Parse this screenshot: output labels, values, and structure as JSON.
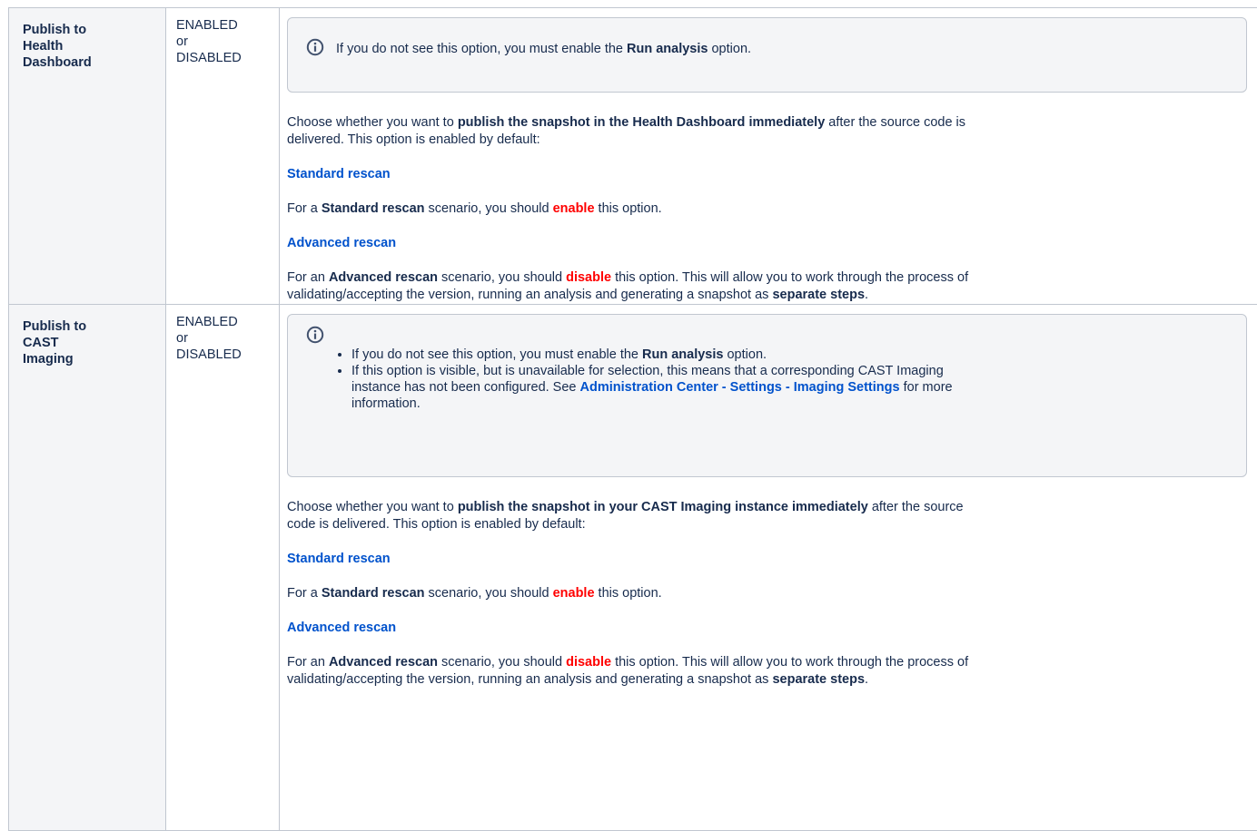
{
  "rows": [
    {
      "name": [
        "Publish to",
        "Health",
        "Dashboard"
      ],
      "values": [
        "ENABLED",
        "or",
        "DISABLED"
      ],
      "info": {
        "pre": "If you do not see this option, you must enable the ",
        "bold": "Run analysis",
        "post": " option."
      },
      "intro": {
        "pre": "Choose whether you want to ",
        "bold": "publish the snapshot in the Health Dashboard immediately",
        "post_line1": " after the source code is",
        "post_line2": "delivered. This option is enabled by default:"
      },
      "standard_heading": "Standard rescan",
      "standard": {
        "pre": "For a ",
        "bold": "Standard rescan",
        "mid": " scenario, you should ",
        "red": "enable",
        "post": " this option."
      },
      "advanced_heading": "Advanced rescan",
      "advanced": {
        "pre": "For an ",
        "bold": "Advanced rescan",
        "mid": " scenario, you should ",
        "red": "disable",
        "post_line1": " this option. This will allow you to work through the process of",
        "post_line2": "validating/accepting the version, running an analysis and generating a snapshot as ",
        "bold2": "separate steps",
        "end": "."
      }
    },
    {
      "name": [
        "Publish to",
        "CAST",
        "Imaging"
      ],
      "values": [
        "ENABLED",
        "or",
        "DISABLED"
      ],
      "info_items": [
        {
          "pre": "If you do not see this option, you must enable the ",
          "bold": "Run analysis",
          "post": " option."
        },
        {
          "line1": "If this option is visible, but is unavailable for selection, this means that a corresponding CAST Imaging",
          "line2": "instance has not been configured. See ",
          "link": "Administration Center - Settings - Imaging Settings",
          "line2_post": " for more",
          "line3": "information."
        }
      ],
      "intro": {
        "pre": "Choose whether you want to ",
        "bold": "publish the snapshot in your CAST Imaging instance immediately",
        "post_line1": " after the source",
        "post_line2": "code is delivered. This option is enabled by default:"
      },
      "standard_heading": "Standard rescan",
      "standard": {
        "pre": "For a ",
        "bold": "Standard rescan",
        "mid": " scenario, you should ",
        "red": "enable",
        "post": " this option."
      },
      "advanced_heading": "Advanced rescan",
      "advanced": {
        "pre": "For an ",
        "bold": "Advanced rescan",
        "mid": " scenario, you should ",
        "red": "disable",
        "post_line1": " this option. This will allow you to work through the process of",
        "post_line2": "validating/accepting the version, running an analysis and generating a snapshot as ",
        "bold2": "separate steps",
        "end": "."
      }
    }
  ],
  "colors": {
    "link": "#0052cc",
    "emphasis_red": "#ff0000",
    "panel_bg": "#f4f5f7",
    "border": "#c1c7d0",
    "icon": "#42526e"
  },
  "icons": {
    "info": "info-icon"
  }
}
